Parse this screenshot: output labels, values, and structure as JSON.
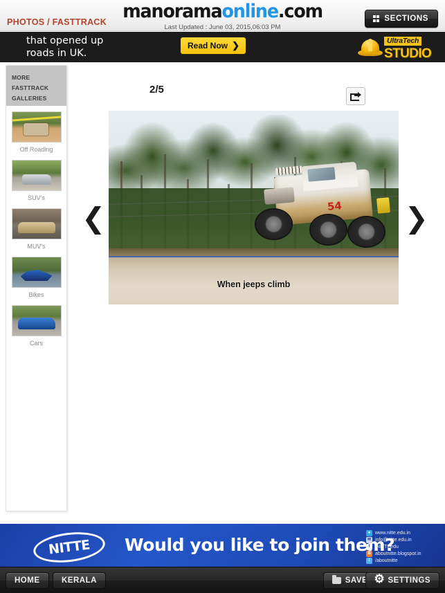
{
  "header": {
    "breadcrumb": "PHOTOS / FASTTRACK",
    "logo_part1": "manorama",
    "logo_part2": "online",
    "logo_part3": ".com",
    "last_updated": "Last Updated : June 03, 2015,06:03 PM",
    "sections_label": "SECTIONS",
    "sections_icon": "grid-icon",
    "accent_color": "#b5432a",
    "logo_blue": "#2196e6"
  },
  "top_ad": {
    "line1": "that opened up",
    "line2": "roads in UK.",
    "cta_label": "Read Now",
    "cta_chevron": "❯",
    "brand_top": "UltraTech",
    "brand_bottom": "STUDIO",
    "brand_icon": "hard-hat-icon",
    "cta_color": "#f5c30a"
  },
  "sidebar": {
    "title_line1": "MORE FASTTRACK",
    "title_line2": "GALLERIES",
    "items": [
      {
        "label": "Off Roading",
        "thumb": "offroad-jeep-thumbnail"
      },
      {
        "label": "SUV's",
        "thumb": "suv-car-thumbnail"
      },
      {
        "label": "MUV's",
        "thumb": "muv-car-thumbnail"
      },
      {
        "label": "Bikes",
        "thumb": "motorcycle-thumbnail"
      },
      {
        "label": "Cars",
        "thumb": "blue-sedan-thumbnail"
      }
    ]
  },
  "viewer": {
    "counter": "2/5",
    "current_index": 2,
    "total": 5,
    "share_icon": "share-export-icon",
    "prev_icon": "chevron-left-icon",
    "next_icon": "chevron-right-icon",
    "prev_glyph": "❮",
    "next_glyph": "❯",
    "photo_caption": "When jeeps climb",
    "photo_alt": "White and mud-covered off-road jeep number 54 airborne over a dirt track with trees in background"
  },
  "bottom_ad": {
    "brand": "NITTE",
    "tagline": "Would you like to join them?",
    "links": [
      {
        "icon": "globe-icon",
        "text": "www.nitte.edu.in"
      },
      {
        "icon": "envelope-icon",
        "text": "info@nitte.edu.in"
      },
      {
        "icon": "facebook-icon",
        "text": "/NITTEedu"
      },
      {
        "icon": "blogger-icon",
        "text": "aboutnitte.blogspot.in"
      },
      {
        "icon": "twitter-icon",
        "text": "/aboutnitte"
      }
    ],
    "bg_color": "#1d49b4"
  },
  "bottom_nav": {
    "home_label": "HOME",
    "kerala_label": "KERALA",
    "saved_label": "SAVED",
    "saved_icon": "folder-icon",
    "settings_label": "SETTINGS",
    "settings_icon": "gear-icon"
  }
}
